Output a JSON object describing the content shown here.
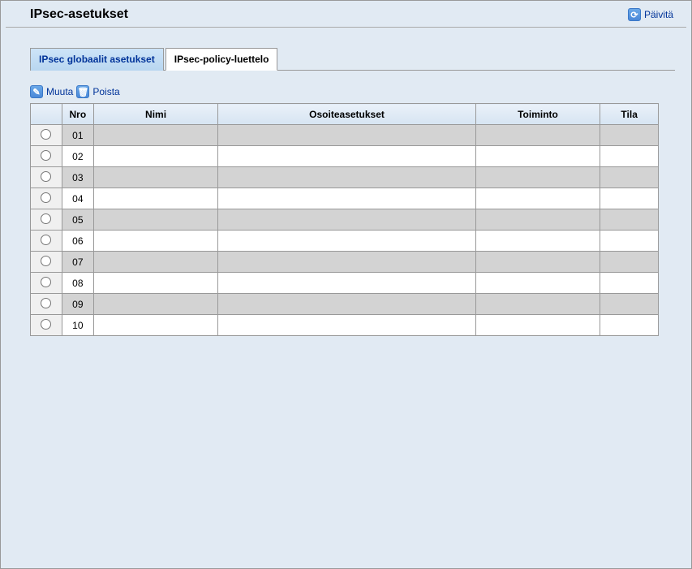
{
  "header": {
    "title": "IPsec-asetukset",
    "refresh_label": "Päivitä"
  },
  "tabs": {
    "global": "IPsec globaalit asetukset",
    "policy": "IPsec-policy-luettelo"
  },
  "toolbar": {
    "edit_label": "Muuta",
    "delete_label": "Poista"
  },
  "table": {
    "headers": {
      "nro": "Nro",
      "nimi": "Nimi",
      "osoite": "Osoiteasetukset",
      "toiminto": "Toiminto",
      "tila": "Tila"
    },
    "rows": [
      {
        "nro": "01",
        "nimi": "",
        "osoite": "",
        "toiminto": "",
        "tila": ""
      },
      {
        "nro": "02",
        "nimi": "",
        "osoite": "",
        "toiminto": "",
        "tila": ""
      },
      {
        "nro": "03",
        "nimi": "",
        "osoite": "",
        "toiminto": "",
        "tila": ""
      },
      {
        "nro": "04",
        "nimi": "",
        "osoite": "",
        "toiminto": "",
        "tila": ""
      },
      {
        "nro": "05",
        "nimi": "",
        "osoite": "",
        "toiminto": "",
        "tila": ""
      },
      {
        "nro": "06",
        "nimi": "",
        "osoite": "",
        "toiminto": "",
        "tila": ""
      },
      {
        "nro": "07",
        "nimi": "",
        "osoite": "",
        "toiminto": "",
        "tila": ""
      },
      {
        "nro": "08",
        "nimi": "",
        "osoite": "",
        "toiminto": "",
        "tila": ""
      },
      {
        "nro": "09",
        "nimi": "",
        "osoite": "",
        "toiminto": "",
        "tila": ""
      },
      {
        "nro": "10",
        "nimi": "",
        "osoite": "",
        "toiminto": "",
        "tila": ""
      }
    ]
  }
}
